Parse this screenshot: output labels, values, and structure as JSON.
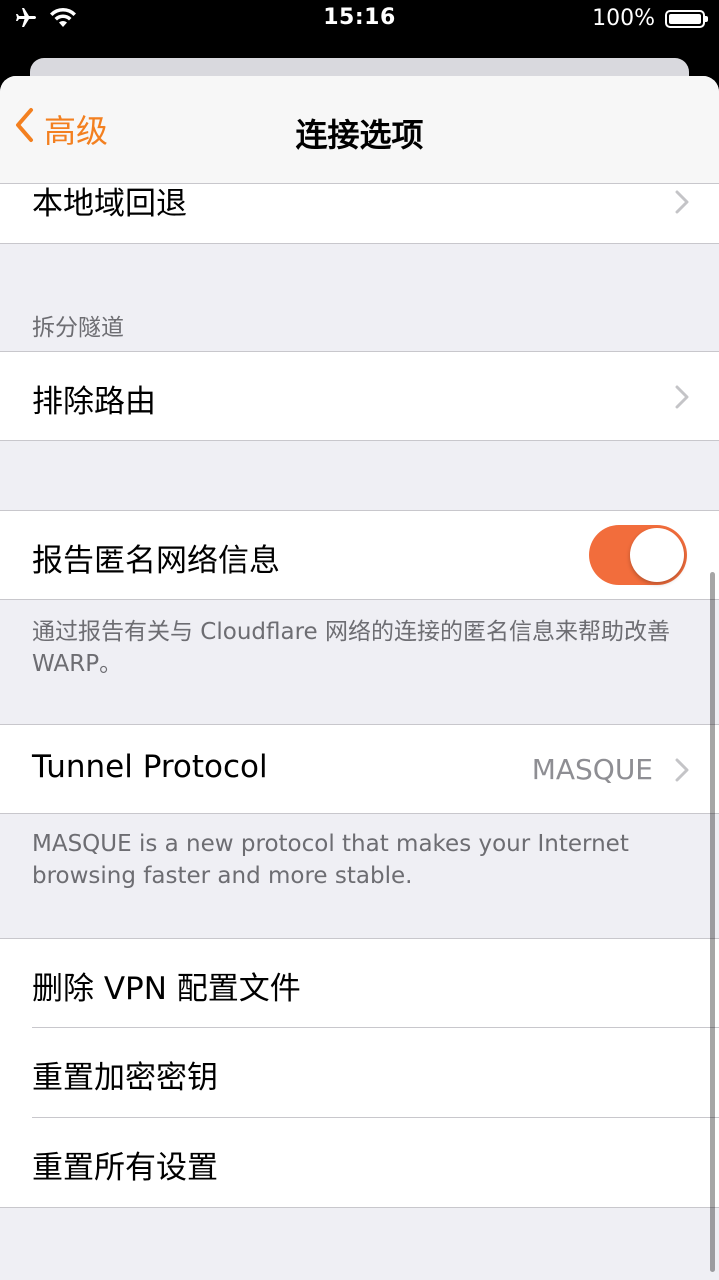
{
  "status_bar": {
    "time": "15:16",
    "battery_percent": "100%",
    "icons": [
      "airplane-icon",
      "wifi-icon",
      "battery-icon"
    ]
  },
  "nav": {
    "back_label": "高级",
    "title": "连接选项"
  },
  "rows": {
    "local_domain_fallback": "本地域回退",
    "split_tunnel_header": "拆分隧道",
    "exclude_routes": "排除路由",
    "report_anon_info": "报告匿名网络信息",
    "report_anon_footer": "通过报告有关与 Cloudflare 网络的连接的匿名信息来帮助改善 WARP。",
    "tunnel_protocol": "Tunnel Protocol",
    "tunnel_protocol_value": "MASQUE",
    "tunnel_protocol_footer": "MASQUE is a new protocol that makes your Internet browsing faster and more stable.",
    "delete_vpn_profile": "删除 VPN 配置文件",
    "reset_encryption_keys": "重置加密密钥",
    "reset_all_settings": "重置所有设置"
  },
  "toggle_state": {
    "report_anon_info": true
  },
  "colors": {
    "accent": "#f38020",
    "toggle_on": "#f26d3c",
    "background": "#efeff4",
    "secondary_text": "#6d6d72"
  }
}
